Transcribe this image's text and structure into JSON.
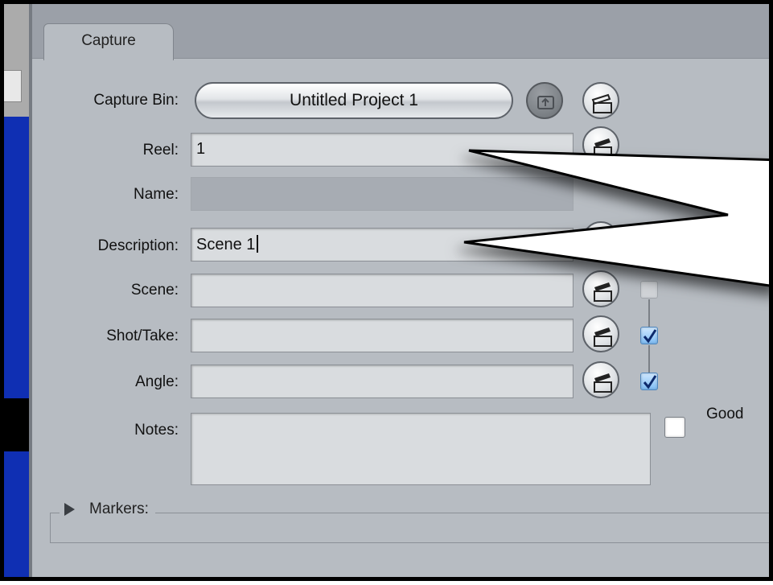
{
  "tab": {
    "label": "Capture"
  },
  "capture_bin": {
    "label": "Capture Bin:",
    "value": "Untitled Project 1"
  },
  "fields": {
    "reel": {
      "label": "Reel:",
      "value": "1"
    },
    "name": {
      "label": "Name:",
      "value": ""
    },
    "description": {
      "label": "Description:",
      "value": "Scene 1"
    },
    "scene": {
      "label": "Scene:",
      "value": ""
    },
    "shot_take": {
      "label": "Shot/Take:",
      "value": ""
    },
    "angle": {
      "label": "Angle:",
      "value": ""
    },
    "notes": {
      "label": "Notes:",
      "value": ""
    }
  },
  "good": {
    "label": "Good",
    "checked": false
  },
  "markers": {
    "label": "Markers:"
  },
  "checkboxes": {
    "scene": false,
    "shot_take": true,
    "angle": true
  },
  "colors": {
    "panel": "#b7bcc2",
    "tabbar": "#9ba0a8",
    "selection_blue": "#0f2fb3",
    "check_blue": "#7fbcf3"
  },
  "icons": {
    "up_folder": "up-folder-icon",
    "new_bin": "new-bin-clapper-icon",
    "clapper": "clapper-icon",
    "disclosure": "disclosure-triangle-icon"
  }
}
